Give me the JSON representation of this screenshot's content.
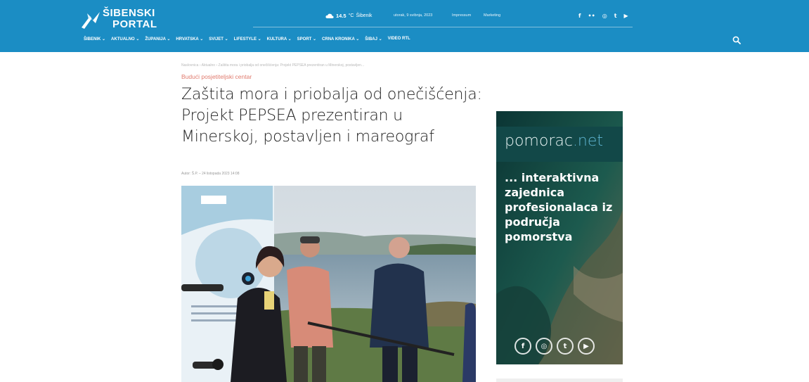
{
  "site": {
    "logo_top": "ŠIBENSKI",
    "logo_bottom": "PORTAL"
  },
  "topbar": {
    "temperature": "14.5",
    "temp_unit": "°C",
    "city": "Šibenik",
    "date": "utorak, 9 svibnja, 2023",
    "impressum": "Impressum",
    "marketing": "Marketing",
    "social": [
      "f",
      "••",
      "◎",
      "t",
      "▶"
    ]
  },
  "nav": {
    "items": [
      "ŠIBENIK ⌄",
      "AKTUALNO ⌄",
      "ŽUPANIJA ⌄",
      "HRVATSKA ⌄",
      "SVIJET ⌄",
      "LIFESTYLE ⌄",
      "KULTURA ⌄",
      "SPORT ⌄",
      "CRNA KRONIKA ⌄",
      "ŠIBAJ ⌄",
      "VIDEO RTL"
    ]
  },
  "article": {
    "breadcrumb": "Naslovnica  ›  Aktualno  ›  Zaštita mora i priobalja od onečišćenja: Projekt PEPSEA prezentiran u Minerskoj, postavljen...",
    "category": "Budući posjetiteljski centar",
    "title": "Zaštita mora i priobalja od onečišćenja: Projekt PEPSEA prezentiran u Minerskoj, postavljen i mareograf",
    "byline": "Autor: Š.P. – 24 listopada 2023 14:08"
  },
  "ad": {
    "brand": "pomorac",
    "brand_suffix": ".net",
    "text": "... interaktivna zajednica profesionalaca iz područja pomorstva",
    "social": [
      "f",
      "◎",
      "t",
      "▶"
    ]
  },
  "colors": {
    "header_bg": "#1b8dc4",
    "category": "#e07a6d",
    "ad_bg": "#0e3a3a"
  }
}
